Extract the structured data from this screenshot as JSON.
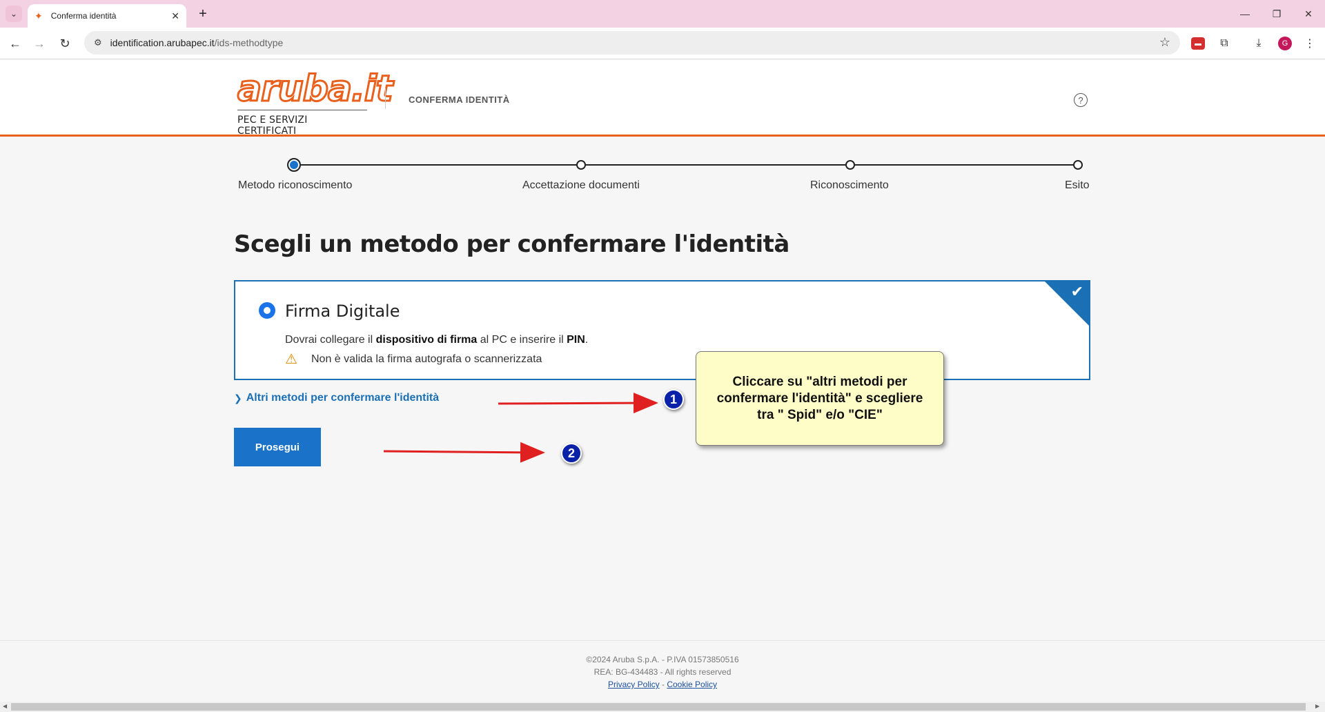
{
  "browser": {
    "tab_title": "Conferma identità",
    "url_host": "identification.arubapec.it",
    "url_path": "/ids-methodtype",
    "avatar_letter": "G"
  },
  "header": {
    "logo_word": "aruba.it",
    "logo_sub": "PEC E SERVIZI CERTIFICATI",
    "title": "CONFERMA IDENTITÀ"
  },
  "stepper": {
    "steps": [
      {
        "label": "Metodo riconoscimento",
        "active": true
      },
      {
        "label": "Accettazione documenti",
        "active": false
      },
      {
        "label": "Riconoscimento",
        "active": false
      },
      {
        "label": "Esito",
        "active": false
      }
    ]
  },
  "main": {
    "title": "Scegli un metodo per confermare l'identità",
    "card": {
      "title": "Firma Digitale",
      "desc_1": "Dovrai collegare il ",
      "desc_b1": "dispositivo di firma",
      "desc_2": " al PC e inserire il ",
      "desc_b2": "PIN",
      "desc_3": ".",
      "warning": "Non è valida la firma autografa o scannerizzata"
    },
    "other_link": "Altri metodi per confermare l'identità",
    "continue_label": "Prosegui"
  },
  "annotations": {
    "callout": "Cliccare su \"altri metodi per confermare l'identità\" e scegliere tra \" Spid\"  e/o \"CIE\"",
    "badge_1": "1",
    "badge_2": "2",
    "arrow_color": "#e02020"
  },
  "footer": {
    "line1": "©2024 Aruba S.p.A. - P.IVA 01573850516",
    "line2": "REA: BG-434483 - All rights reserved",
    "privacy": "Privacy Policy",
    "sep": " - ",
    "cookie": "Cookie Policy"
  },
  "colors": {
    "brand_orange": "#e8601c",
    "primary_blue": "#1a73c8",
    "tab_bar": "#f3d3e3"
  }
}
